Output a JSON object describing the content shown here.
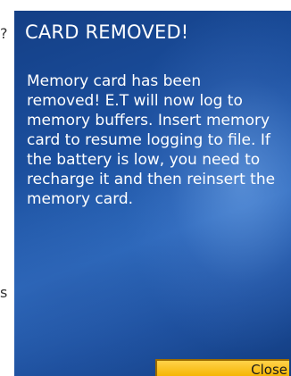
{
  "screen_edge": {
    "top_glyph": "?",
    "bottom_glyph": "s"
  },
  "dialog": {
    "title": "CARD REMOVED!",
    "message": "Memory card has been removed! E.T will now log to memory buffers. Insert memory card to resume logging to file. If the battery is low, you need to recharge it and then reinsert the memory card.",
    "close_label": "Close",
    "colors": {
      "background": "#1b4f9e",
      "text": "#ffffff",
      "button": "#f5b400"
    }
  }
}
